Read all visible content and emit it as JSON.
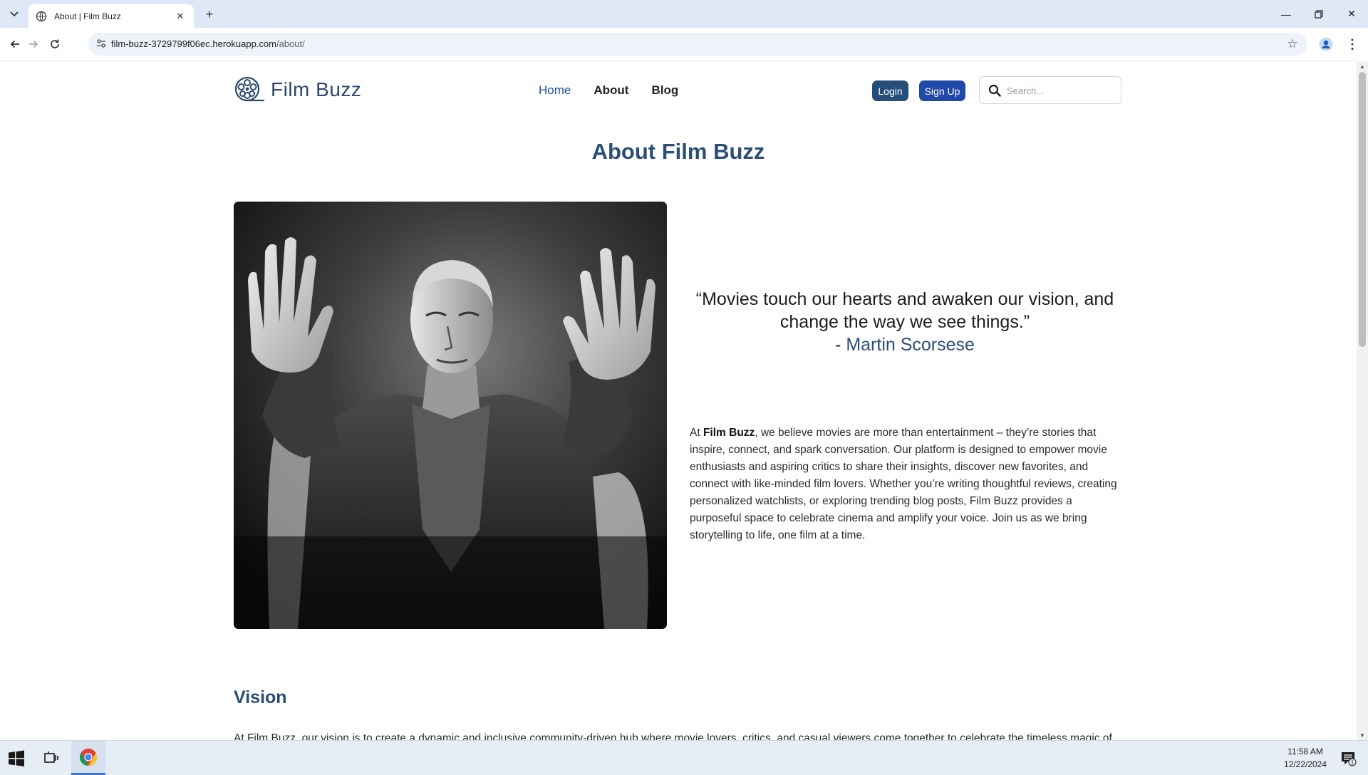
{
  "browser": {
    "tab_title": "About | Film Buzz",
    "url_host": "film-buzz-3729799f06ec.herokuapp.com",
    "url_path": "/about/"
  },
  "site": {
    "brand": "Film Buzz",
    "nav": [
      {
        "label": "Home",
        "active": true
      },
      {
        "label": "About",
        "active": false
      },
      {
        "label": "Blog",
        "active": false
      }
    ],
    "login_label": "Login",
    "signup_label": "Sign Up",
    "search_placeholder": "Search..."
  },
  "about": {
    "title": "About Film Buzz",
    "quote_text": "“Movies touch our hearts and awaken our vision, and change the way we see things.”",
    "quote_dash": "- ",
    "quote_author": "Martin Scorsese",
    "intro_prefix": "At ",
    "intro_brand": "Film Buzz",
    "intro_body": ", we believe movies are more than entertainment – they’re stories that inspire, connect, and spark conversation. Our platform is designed to empower movie enthusiasts and aspiring critics to share their insights, discover new favorites, and connect with like-minded film lovers. Whether you’re writing thoughtful reviews, creating personalized watchlists, or exploring trending blog posts, Film Buzz provides a purposeful space to celebrate cinema and amplify your voice. Join us as we bring storytelling to life, one film at a time.",
    "vision_heading": "Vision",
    "vision_text": "At Film Buzz, our vision is to create a dynamic and inclusive community-driven hub where movie lovers, critics, and casual viewers come together to celebrate the timeless magic of"
  },
  "taskbar": {
    "time": "11:58 AM",
    "date": "12/22/2024",
    "notification_count": "1"
  },
  "colors": {
    "brand_navy": "#2b4e77",
    "link_blue": "#1e4fa8",
    "login_bg": "#254f78",
    "signup_bg": "#1f48a8"
  }
}
